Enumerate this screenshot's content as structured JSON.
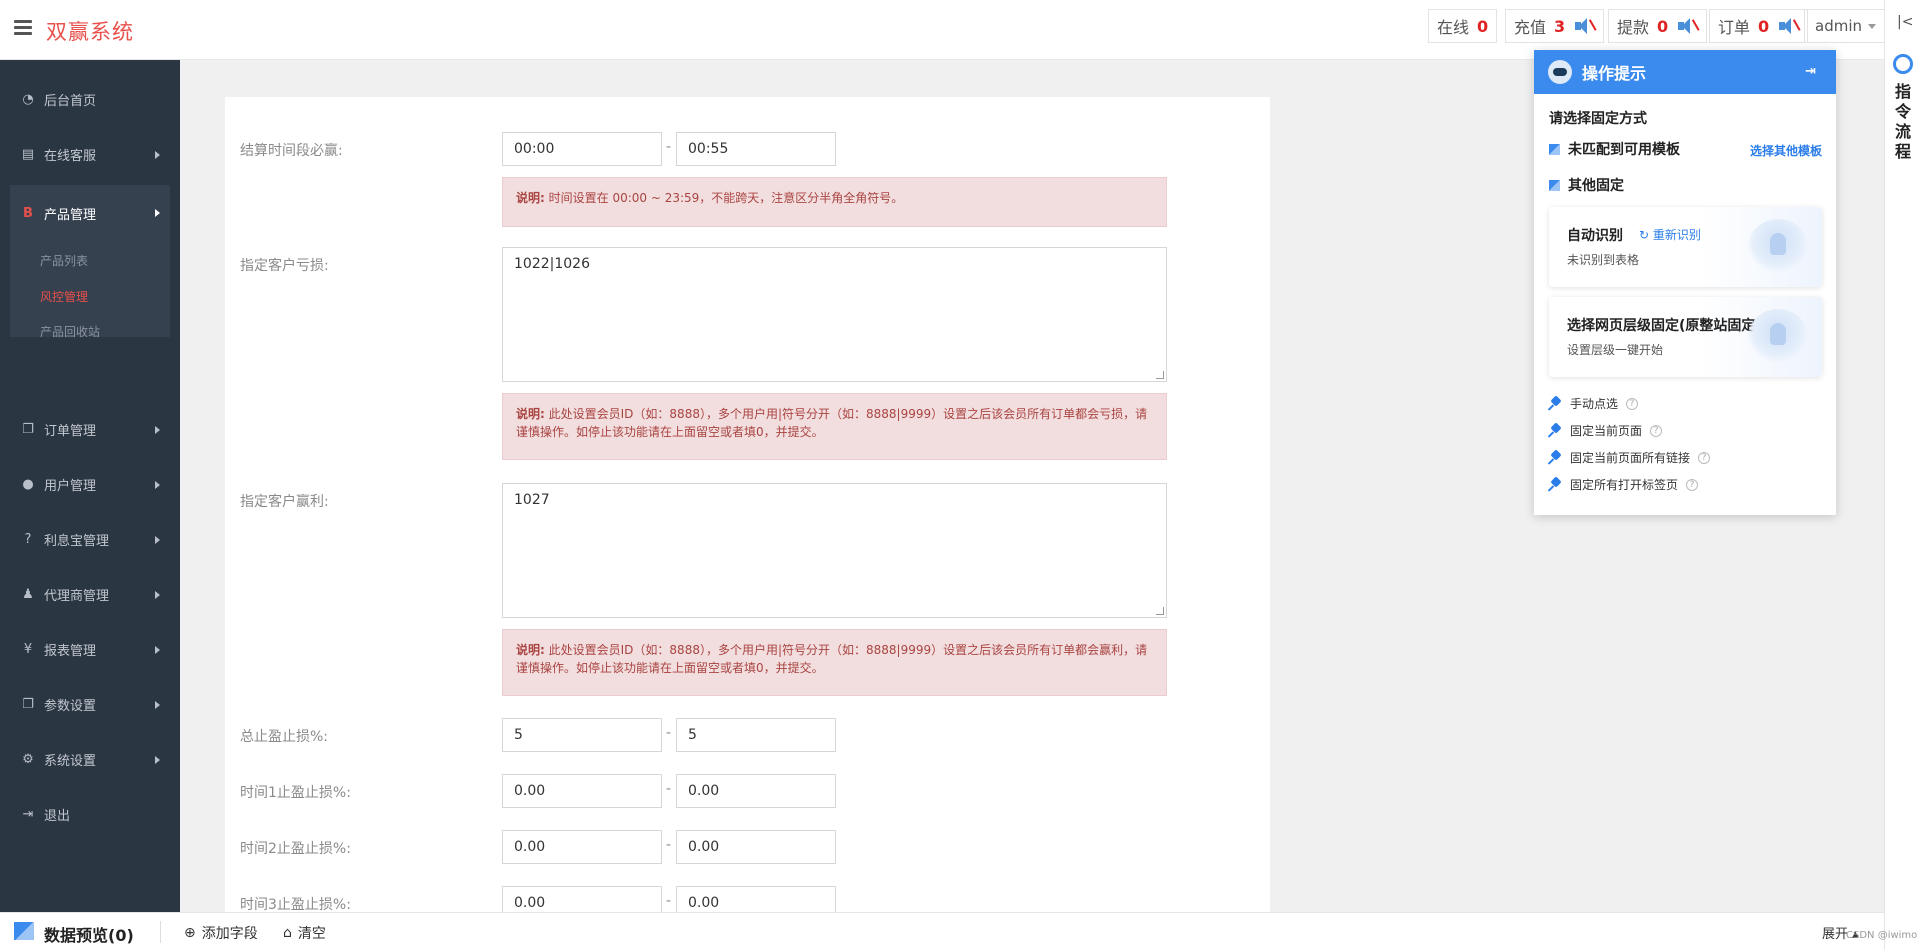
{
  "header": {
    "brand": "双赢系统",
    "stats": [
      {
        "label": "在线",
        "count": "0"
      },
      {
        "label": "充值",
        "count": "3"
      },
      {
        "label": "提款",
        "count": "0"
      },
      {
        "label": "订单",
        "count": "0"
      }
    ],
    "user": "admin"
  },
  "sidebar": {
    "items": [
      {
        "label": "后台首页",
        "icon": "dashboard-icon"
      },
      {
        "label": "在线客服",
        "icon": "book-icon"
      },
      {
        "label": "产品管理",
        "icon": "bitcoin-icon"
      },
      {
        "label": "订单管理",
        "icon": "copy-icon"
      },
      {
        "label": "用户管理",
        "icon": "user-icon"
      },
      {
        "label": "利息宝管理",
        "icon": "help-circle-icon"
      },
      {
        "label": "代理商管理",
        "icon": "agent-icon"
      },
      {
        "label": "报表管理",
        "icon": "yen-icon"
      },
      {
        "label": "参数设置",
        "icon": "copy-icon"
      },
      {
        "label": "系统设置",
        "icon": "gears-icon"
      },
      {
        "label": "退出",
        "icon": "logout-icon"
      }
    ],
    "submenu": [
      "产品列表",
      "风控管理",
      "产品回收站"
    ]
  },
  "form": {
    "settle_label": "结算时间段必赢:",
    "settle_start": "00:00",
    "settle_end": "00:55",
    "settle_note_bold": "说明:",
    "settle_note": "时间设置在 00:00 ~ 23:59，不能跨天，注意区分半角全角符号。",
    "loss_label": "指定客户亏损:",
    "loss_value": "1022|1026",
    "loss_note_bold": "说明:",
    "loss_note": "此处设置会员ID（如：8888），多个用户用|符号分开（如：8888|9999）设置之后该会员所有订单都会亏损，请谨慎操作。如停止该功能请在上面留空或者填0，并提交。",
    "win_label": "指定客户赢利:",
    "win_value": "1027",
    "win_note_bold": "说明:",
    "win_note": "此处设置会员ID（如：8888），多个用户用|符号分开（如：8888|9999）设置之后该会员所有订单都会赢利，请谨慎操作。如停止该功能请在上面留空或者填0，并提交。",
    "ranges": [
      {
        "label": "总止盈止损%:",
        "a": "5",
        "b": "5"
      },
      {
        "label": "时间1止盈止损%:",
        "a": "0.00",
        "b": "0.00"
      },
      {
        "label": "时间2止盈止损%:",
        "a": "0.00",
        "b": "0.00"
      },
      {
        "label": "时间3止盈止损%:",
        "a": "0.00",
        "b": "0.00"
      }
    ],
    "dash": "-"
  },
  "helper": {
    "title": "操作提示",
    "section_title": "请选择固定方式",
    "option1": "未匹配到可用模板",
    "option1_link": "选择其他模板",
    "option2": "其他固定",
    "card1_title": "自动识别",
    "card1_link": "重新识别",
    "card1_sub": "未识别到表格",
    "card2_title": "选择网页层级固定(原整站固定)",
    "card2_sub": "设置层级一键开始",
    "tools": [
      "手动点选",
      "固定当前页面",
      "固定当前页面所有链接",
      "固定所有打开标签页"
    ]
  },
  "strip": {
    "vertical_text": "指令流程"
  },
  "bottom": {
    "title": "数据预览(0)",
    "add_field": "添加字段",
    "clear": "清空",
    "expand": "展开",
    "watermark": "CSDN @iwimo"
  }
}
